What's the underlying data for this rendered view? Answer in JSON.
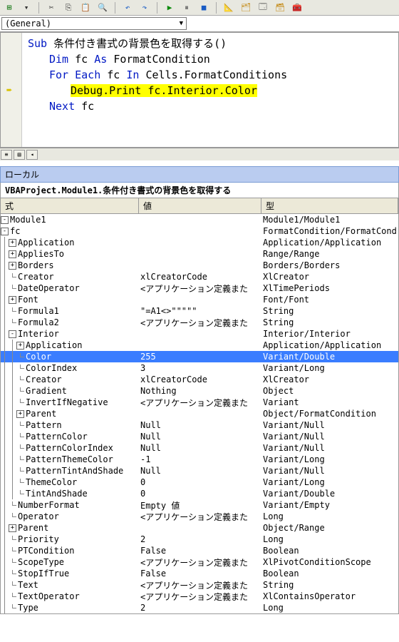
{
  "toolbar": {
    "combo_general": "(General)"
  },
  "code": {
    "sub_kw": "Sub",
    "sub_name": "条件付き書式の背景色を取得する()",
    "dim_kw": "Dim",
    "dim_var": "fc",
    "as_kw": "As",
    "dim_type": "FormatCondition",
    "for_kw": "For Each",
    "for_var": "fc",
    "in_kw": "In",
    "for_coll": "Cells.FormatConditions",
    "debug": "Debug.Print fc.Interior.Color",
    "next_kw": "Next",
    "next_var": "fc"
  },
  "locals": {
    "title": "ローカル",
    "context": "VBAProject.Module1.条件付き書式の背景色を取得する",
    "headers": {
      "expr": "式",
      "val": "値",
      "type": "型"
    },
    "rows": [
      {
        "d": 0,
        "i": "box",
        "s": "-",
        "n": "Module1",
        "v": "",
        "t": "Module1/Module1"
      },
      {
        "d": 0,
        "i": "box",
        "s": "-",
        "n": "fc",
        "v": "",
        "t": "FormatCondition/FormatCond"
      },
      {
        "d": 1,
        "i": "box",
        "s": "+",
        "n": "Application",
        "v": "",
        "t": "Application/Application"
      },
      {
        "d": 1,
        "i": "box",
        "s": "+",
        "n": "AppliesTo",
        "v": "",
        "t": "Range/Range"
      },
      {
        "d": 1,
        "i": "box",
        "s": "+",
        "n": "Borders",
        "v": "",
        "t": "Borders/Borders"
      },
      {
        "d": 1,
        "i": "leaf",
        "n": "Creator",
        "v": "xlCreatorCode",
        "t": "XlCreator"
      },
      {
        "d": 1,
        "i": "leaf",
        "n": "DateOperator",
        "v": "<アプリケーション定義また",
        "t": "XlTimePeriods"
      },
      {
        "d": 1,
        "i": "box",
        "s": "+",
        "n": "Font",
        "v": "",
        "t": "Font/Font"
      },
      {
        "d": 1,
        "i": "leaf",
        "n": "Formula1",
        "v": "\"=A1<>\"\"\"\"\"",
        "t": "String"
      },
      {
        "d": 1,
        "i": "leaf",
        "n": "Formula2",
        "v": "<アプリケーション定義また",
        "t": "String"
      },
      {
        "d": 1,
        "i": "box",
        "s": "-",
        "n": "Interior",
        "v": "",
        "t": "Interior/Interior"
      },
      {
        "d": 2,
        "i": "box",
        "s": "+",
        "n": "Application",
        "v": "",
        "t": "Application/Application"
      },
      {
        "d": 2,
        "i": "leaf",
        "n": "Color",
        "v": "255",
        "t": "Variant/Double",
        "sel": true
      },
      {
        "d": 2,
        "i": "leaf",
        "n": "ColorIndex",
        "v": "3",
        "t": "Variant/Long"
      },
      {
        "d": 2,
        "i": "leaf",
        "n": "Creator",
        "v": "xlCreatorCode",
        "t": "XlCreator"
      },
      {
        "d": 2,
        "i": "leaf",
        "n": "Gradient",
        "v": "Nothing",
        "t": "Object"
      },
      {
        "d": 2,
        "i": "leaf",
        "n": "InvertIfNegative",
        "v": "<アプリケーション定義また",
        "t": "Variant"
      },
      {
        "d": 2,
        "i": "box",
        "s": "+",
        "n": "Parent",
        "v": "",
        "t": "Object/FormatCondition"
      },
      {
        "d": 2,
        "i": "leaf",
        "n": "Pattern",
        "v": "Null",
        "t": "Variant/Null"
      },
      {
        "d": 2,
        "i": "leaf",
        "n": "PatternColor",
        "v": "Null",
        "t": "Variant/Null"
      },
      {
        "d": 2,
        "i": "leaf",
        "n": "PatternColorIndex",
        "v": "Null",
        "t": "Variant/Null"
      },
      {
        "d": 2,
        "i": "leaf",
        "n": "PatternThemeColor",
        "v": "-1",
        "t": "Variant/Long"
      },
      {
        "d": 2,
        "i": "leaf",
        "n": "PatternTintAndShade",
        "v": "Null",
        "t": "Variant/Null"
      },
      {
        "d": 2,
        "i": "leaf",
        "n": "ThemeColor",
        "v": "0",
        "t": "Variant/Long"
      },
      {
        "d": 2,
        "i": "leaf",
        "n": "TintAndShade",
        "v": "0",
        "t": "Variant/Double"
      },
      {
        "d": 1,
        "i": "leaf",
        "n": "NumberFormat",
        "v": "Empty 値",
        "t": "Variant/Empty"
      },
      {
        "d": 1,
        "i": "leaf",
        "n": "Operator",
        "v": "<アプリケーション定義また",
        "t": "Long"
      },
      {
        "d": 1,
        "i": "box",
        "s": "+",
        "n": "Parent",
        "v": "",
        "t": "Object/Range"
      },
      {
        "d": 1,
        "i": "leaf",
        "n": "Priority",
        "v": "2",
        "t": "Long"
      },
      {
        "d": 1,
        "i": "leaf",
        "n": "PTCondition",
        "v": "False",
        "t": "Boolean"
      },
      {
        "d": 1,
        "i": "leaf",
        "n": "ScopeType",
        "v": "<アプリケーション定義また",
        "t": "XlPivotConditionScope"
      },
      {
        "d": 1,
        "i": "leaf",
        "n": "StopIfTrue",
        "v": "False",
        "t": "Boolean"
      },
      {
        "d": 1,
        "i": "leaf",
        "n": "Text",
        "v": "<アプリケーション定義また",
        "t": "String"
      },
      {
        "d": 1,
        "i": "leaf",
        "n": "TextOperator",
        "v": "<アプリケーション定義また",
        "t": "XlContainsOperator"
      },
      {
        "d": 1,
        "i": "leaf",
        "n": "Type",
        "v": "2",
        "t": "Long"
      }
    ]
  }
}
